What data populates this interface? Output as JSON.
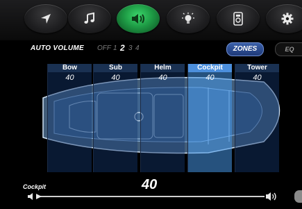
{
  "nav": {
    "items": [
      "navigation-icon",
      "music-icon",
      "speaker-volume-icon",
      "light-bulb-icon",
      "remote-icon",
      "gear-icon"
    ],
    "active_index": 2,
    "active_color": "#2fc75b"
  },
  "auto_volume": {
    "label": "AUTO VOLUME",
    "options": [
      "OFF",
      "1",
      "2",
      "3",
      "4"
    ],
    "selected": "2"
  },
  "view_toggle": {
    "zones": "ZONES",
    "eq": "EQ",
    "selected": "ZONES"
  },
  "zones": [
    {
      "name": "Bow",
      "value": "40"
    },
    {
      "name": "Sub",
      "value": "40"
    },
    {
      "name": "Helm",
      "value": "40"
    },
    {
      "name": "Cockpit",
      "value": "40",
      "selected": true
    },
    {
      "name": "Tower",
      "value": "40"
    }
  ],
  "bottom": {
    "zone_label": "Cockpit",
    "volume": "40",
    "volume_fraction": 0.0
  },
  "colors": {
    "zone_bg": "#14376e",
    "zone_active": "#4c8fdc",
    "boat_line": "#8fb6e0"
  }
}
